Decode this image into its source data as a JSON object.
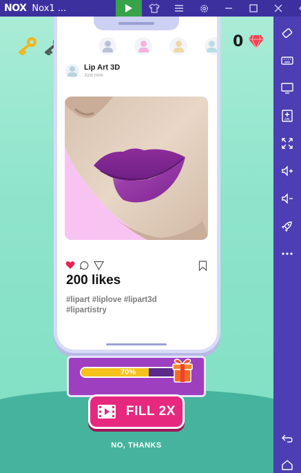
{
  "window": {
    "logo": "NOX",
    "title": "Nox1 ...",
    "toolbar_icons": [
      "play-store-icon",
      "shirt-icon",
      "menu-icon",
      "gear-icon",
      "minimize-icon",
      "maximize-icon",
      "close-icon",
      "collapse-sidebar-icon"
    ]
  },
  "sidebar": {
    "icons": [
      "rotate-screen-icon",
      "keyboard-icon",
      "screen-icon",
      "apk-install-icon",
      "fullscreen-icon",
      "volume-up-icon",
      "volume-down-icon",
      "rocket-icon",
      "more-icon",
      "back-icon",
      "home-icon"
    ]
  },
  "hud": {
    "keys_total": 3,
    "keys_collected": 1,
    "key_color_active": "#f1b71b",
    "key_color_inactive": "#505a5a",
    "diamond_count": "0",
    "diamond_color": "#f2424f"
  },
  "stories": {
    "avatar_colors": [
      "#b9c0d8",
      "#f0b4dd",
      "#ecd9a8",
      "#b9dde8"
    ]
  },
  "post": {
    "username": "Lip Art 3D",
    "time": "Just now",
    "likes": "200 likes",
    "tags": "#lipart #liplove #lipart3d #lipartistry",
    "liked": true,
    "lip_color": "#8f2f9f"
  },
  "progress": {
    "percent": 70,
    "label": "70%"
  },
  "buttons": {
    "fill": "FILL 2X",
    "no_thanks": "NO, THANKS"
  },
  "colors": {
    "emulator_purple": "#4b3fb3",
    "game_bg": "#8ee4cb",
    "button_pink": "#e6287f",
    "panel_purple": "#9d3fbf"
  }
}
